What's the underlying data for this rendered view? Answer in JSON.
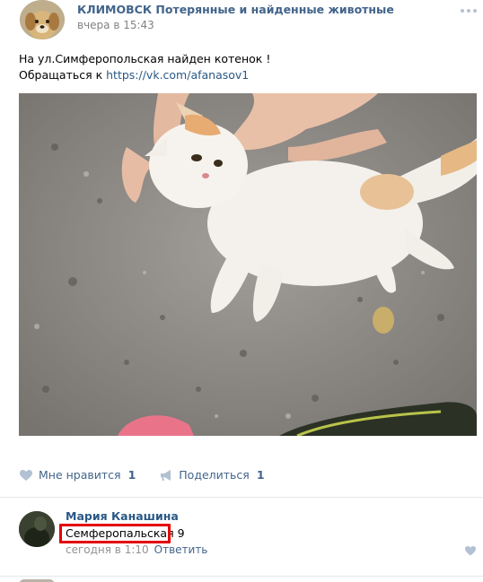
{
  "post": {
    "group_name": "КЛИМОВСК Потерянные и найденные животные",
    "time": "вчера в 15:43",
    "text_line1": "На ул.Симферопольская найден котенок !",
    "text_line2_prefix": "Обращаться к ",
    "text_link": "https://vk.com/afanasov1"
  },
  "actions": {
    "like_label": "Мне нравится",
    "like_count": "1",
    "share_label": "Поделиться",
    "share_count": "1"
  },
  "comment": {
    "author": "Мария Канашина",
    "text": "Семферопальская 9",
    "time": "сегодня в 1:10",
    "reply_label": "Ответить"
  },
  "colors": {
    "link": "#2a5885",
    "group_name": "#42648b",
    "muted": "#828282",
    "highlight_box": "#e40000"
  }
}
